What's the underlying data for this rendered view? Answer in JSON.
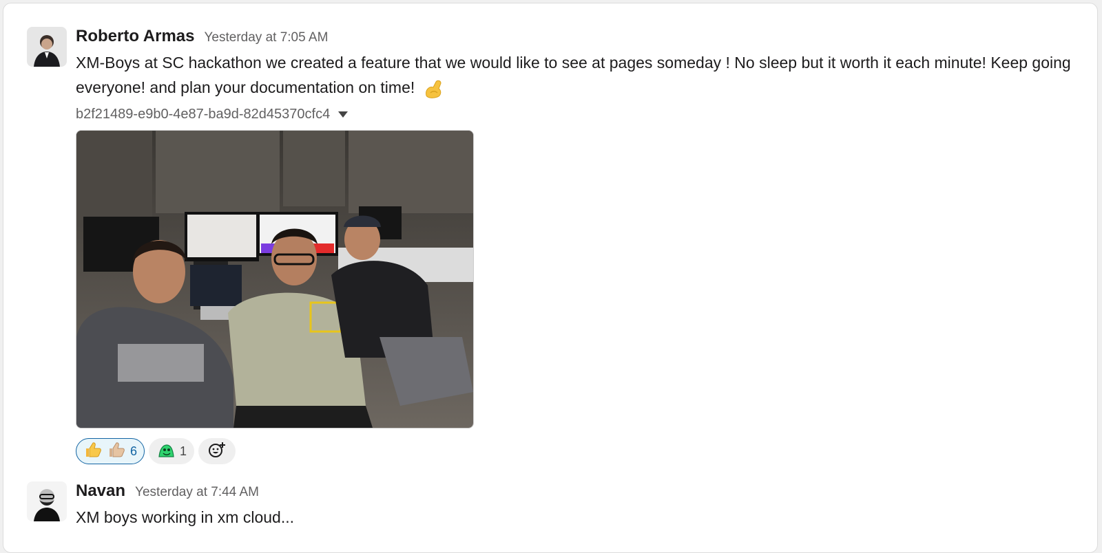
{
  "messages": [
    {
      "author": "Roberto Armas",
      "time": "Yesterday at 7:05 AM",
      "text": "XM-Boys at SC hackathon we created a feature that we would like to see at pages someday ! No sleep but it worth it each minute! Keep going everyone! and plan your documentation on time!",
      "emoji": "flexed-biceps",
      "file_name": "b2f21489-e9b0-4e87-ba9d-82d45370cfc4",
      "reactions": [
        {
          "emoji": [
            "thumbs-up",
            "thumbs-up-light-skin"
          ],
          "count": "6",
          "active": true
        },
        {
          "emoji": [
            "green-mascot"
          ],
          "count": "1",
          "active": false
        }
      ]
    },
    {
      "author": "Navan",
      "time": "Yesterday at 7:44 AM",
      "text": "XM boys working in xm cloud..."
    }
  ],
  "colors": {
    "link_blue": "#1264a3",
    "muted": "#616061"
  }
}
